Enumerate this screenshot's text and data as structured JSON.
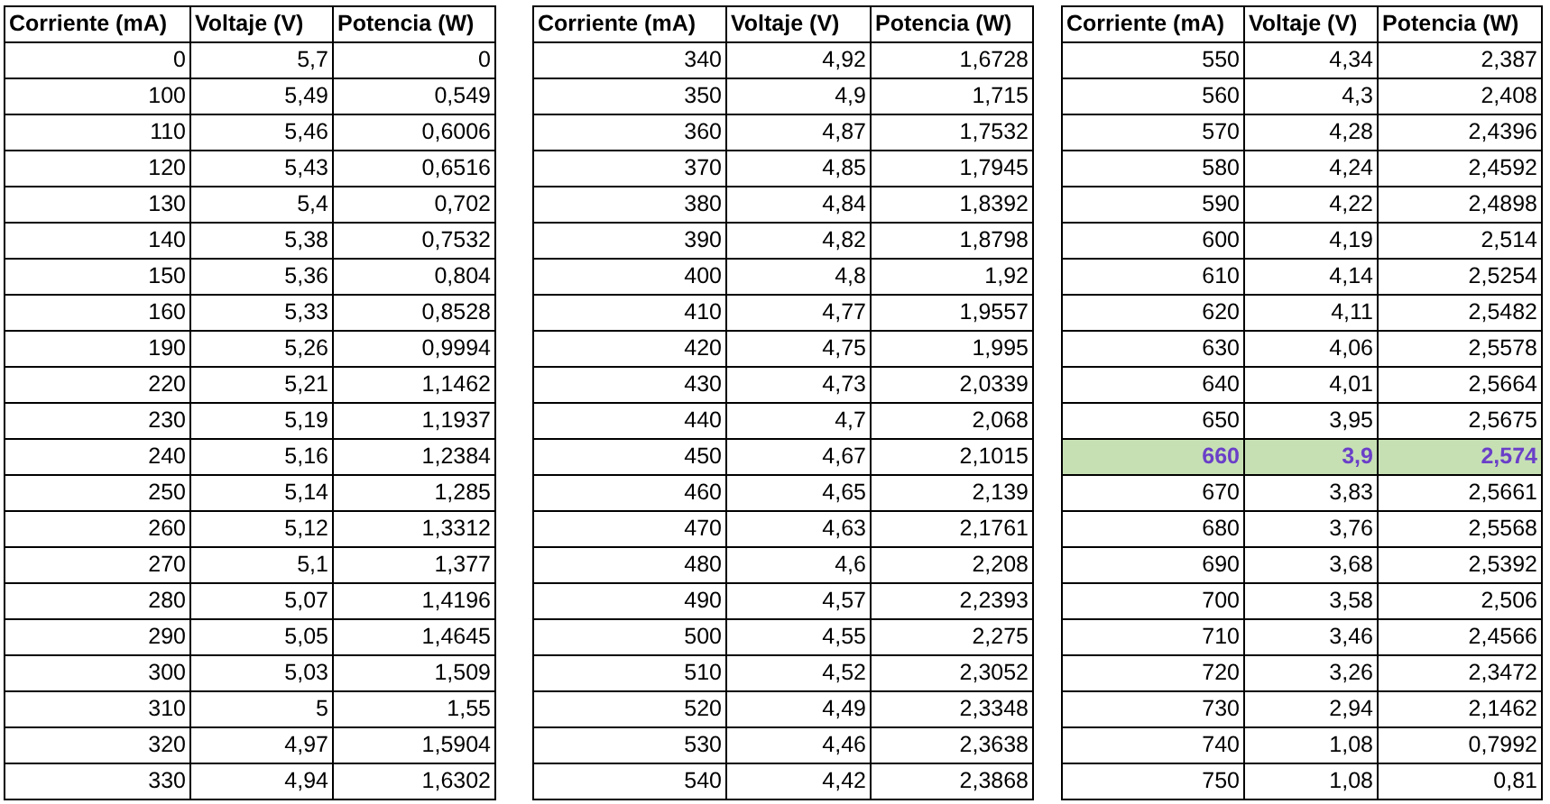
{
  "tables": [
    {
      "columns": [
        "Corriente (mA)",
        "Voltaje (V)",
        "Potencia (W)"
      ],
      "rows": [
        {
          "cells": [
            "0",
            "5,7",
            "0"
          ],
          "highlighted": false
        },
        {
          "cells": [
            "100",
            "5,49",
            "0,549"
          ],
          "highlighted": false
        },
        {
          "cells": [
            "110",
            "5,46",
            "0,6006"
          ],
          "highlighted": false
        },
        {
          "cells": [
            "120",
            "5,43",
            "0,6516"
          ],
          "highlighted": false
        },
        {
          "cells": [
            "130",
            "5,4",
            "0,702"
          ],
          "highlighted": false
        },
        {
          "cells": [
            "140",
            "5,38",
            "0,7532"
          ],
          "highlighted": false
        },
        {
          "cells": [
            "150",
            "5,36",
            "0,804"
          ],
          "highlighted": false
        },
        {
          "cells": [
            "160",
            "5,33",
            "0,8528"
          ],
          "highlighted": false
        },
        {
          "cells": [
            "190",
            "5,26",
            "0,9994"
          ],
          "highlighted": false
        },
        {
          "cells": [
            "220",
            "5,21",
            "1,1462"
          ],
          "highlighted": false
        },
        {
          "cells": [
            "230",
            "5,19",
            "1,1937"
          ],
          "highlighted": false
        },
        {
          "cells": [
            "240",
            "5,16",
            "1,2384"
          ],
          "highlighted": false
        },
        {
          "cells": [
            "250",
            "5,14",
            "1,285"
          ],
          "highlighted": false
        },
        {
          "cells": [
            "260",
            "5,12",
            "1,3312"
          ],
          "highlighted": false
        },
        {
          "cells": [
            "270",
            "5,1",
            "1,377"
          ],
          "highlighted": false
        },
        {
          "cells": [
            "280",
            "5,07",
            "1,4196"
          ],
          "highlighted": false
        },
        {
          "cells": [
            "290",
            "5,05",
            "1,4645"
          ],
          "highlighted": false
        },
        {
          "cells": [
            "300",
            "5,03",
            "1,509"
          ],
          "highlighted": false
        },
        {
          "cells": [
            "310",
            "5",
            "1,55"
          ],
          "highlighted": false
        },
        {
          "cells": [
            "320",
            "4,97",
            "1,5904"
          ],
          "highlighted": false
        },
        {
          "cells": [
            "330",
            "4,94",
            "1,6302"
          ],
          "highlighted": false
        }
      ]
    },
    {
      "columns": [
        "Corriente (mA)",
        "Voltaje (V)",
        "Potencia (W)"
      ],
      "rows": [
        {
          "cells": [
            "340",
            "4,92",
            "1,6728"
          ],
          "highlighted": false
        },
        {
          "cells": [
            "350",
            "4,9",
            "1,715"
          ],
          "highlighted": false
        },
        {
          "cells": [
            "360",
            "4,87",
            "1,7532"
          ],
          "highlighted": false
        },
        {
          "cells": [
            "370",
            "4,85",
            "1,7945"
          ],
          "highlighted": false
        },
        {
          "cells": [
            "380",
            "4,84",
            "1,8392"
          ],
          "highlighted": false
        },
        {
          "cells": [
            "390",
            "4,82",
            "1,8798"
          ],
          "highlighted": false
        },
        {
          "cells": [
            "400",
            "4,8",
            "1,92"
          ],
          "highlighted": false
        },
        {
          "cells": [
            "410",
            "4,77",
            "1,9557"
          ],
          "highlighted": false
        },
        {
          "cells": [
            "420",
            "4,75",
            "1,995"
          ],
          "highlighted": false
        },
        {
          "cells": [
            "430",
            "4,73",
            "2,0339"
          ],
          "highlighted": false
        },
        {
          "cells": [
            "440",
            "4,7",
            "2,068"
          ],
          "highlighted": false
        },
        {
          "cells": [
            "450",
            "4,67",
            "2,1015"
          ],
          "highlighted": false
        },
        {
          "cells": [
            "460",
            "4,65",
            "2,139"
          ],
          "highlighted": false
        },
        {
          "cells": [
            "470",
            "4,63",
            "2,1761"
          ],
          "highlighted": false
        },
        {
          "cells": [
            "480",
            "4,6",
            "2,208"
          ],
          "highlighted": false
        },
        {
          "cells": [
            "490",
            "4,57",
            "2,2393"
          ],
          "highlighted": false
        },
        {
          "cells": [
            "500",
            "4,55",
            "2,275"
          ],
          "highlighted": false
        },
        {
          "cells": [
            "510",
            "4,52",
            "2,3052"
          ],
          "highlighted": false
        },
        {
          "cells": [
            "520",
            "4,49",
            "2,3348"
          ],
          "highlighted": false
        },
        {
          "cells": [
            "530",
            "4,46",
            "2,3638"
          ],
          "highlighted": false
        },
        {
          "cells": [
            "540",
            "4,42",
            "2,3868"
          ],
          "highlighted": false
        }
      ]
    },
    {
      "columns": [
        "Corriente (mA)",
        "Voltaje (V)",
        "Potencia (W)"
      ],
      "rows": [
        {
          "cells": [
            "550",
            "4,34",
            "2,387"
          ],
          "highlighted": false
        },
        {
          "cells": [
            "560",
            "4,3",
            "2,408"
          ],
          "highlighted": false
        },
        {
          "cells": [
            "570",
            "4,28",
            "2,4396"
          ],
          "highlighted": false
        },
        {
          "cells": [
            "580",
            "4,24",
            "2,4592"
          ],
          "highlighted": false
        },
        {
          "cells": [
            "590",
            "4,22",
            "2,4898"
          ],
          "highlighted": false
        },
        {
          "cells": [
            "600",
            "4,19",
            "2,514"
          ],
          "highlighted": false
        },
        {
          "cells": [
            "610",
            "4,14",
            "2,5254"
          ],
          "highlighted": false
        },
        {
          "cells": [
            "620",
            "4,11",
            "2,5482"
          ],
          "highlighted": false
        },
        {
          "cells": [
            "630",
            "4,06",
            "2,5578"
          ],
          "highlighted": false
        },
        {
          "cells": [
            "640",
            "4,01",
            "2,5664"
          ],
          "highlighted": false
        },
        {
          "cells": [
            "650",
            "3,95",
            "2,5675"
          ],
          "highlighted": false
        },
        {
          "cells": [
            "660",
            "3,9",
            "2,574"
          ],
          "highlighted": true
        },
        {
          "cells": [
            "670",
            "3,83",
            "2,5661"
          ],
          "highlighted": false
        },
        {
          "cells": [
            "680",
            "3,76",
            "2,5568"
          ],
          "highlighted": false
        },
        {
          "cells": [
            "690",
            "3,68",
            "2,5392"
          ],
          "highlighted": false
        },
        {
          "cells": [
            "700",
            "3,58",
            "2,506"
          ],
          "highlighted": false
        },
        {
          "cells": [
            "710",
            "3,46",
            "2,4566"
          ],
          "highlighted": false
        },
        {
          "cells": [
            "720",
            "3,26",
            "2,3472"
          ],
          "highlighted": false
        },
        {
          "cells": [
            "730",
            "2,94",
            "2,1462"
          ],
          "highlighted": false
        },
        {
          "cells": [
            "740",
            "1,08",
            "0,7992"
          ],
          "highlighted": false
        },
        {
          "cells": [
            "750",
            "1,08",
            "0,81"
          ],
          "highlighted": false
        }
      ]
    }
  ]
}
